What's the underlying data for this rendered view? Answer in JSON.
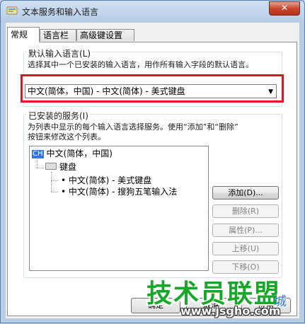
{
  "window": {
    "title": "文本服务和输入语言",
    "close_glyph": "✕"
  },
  "tabs": [
    {
      "label": "常规",
      "active": true
    },
    {
      "label": "语言栏",
      "active": false
    },
    {
      "label": "高级键设置",
      "active": false
    }
  ],
  "default_language": {
    "group_label": "默认输入语言(L)",
    "description": "选择其中一个已安装的输入语言，用作所有输入字段的默认语言。",
    "selected": "中文(简体，中国) - 中文(简体) - 美式键盘",
    "dropdown_arrow": "▼"
  },
  "installed_services": {
    "group_label": "已安装的服务(I)",
    "description_line1": "为列表中显示的每个输入语言选择服务。使用“添加”和“删除”",
    "description_line2": "按钮来修改这个列表。",
    "tree": {
      "language_badge": "CH",
      "language": "中文(简体，中国)",
      "category": "键盘",
      "items": [
        "•  中文(简体) - 美式键盘",
        "•  中文(简体) - 搜狗五笔输入法"
      ]
    },
    "buttons": {
      "add": "添加(D)...",
      "remove": "删除(R)",
      "properties": "属性(P)...",
      "move_up": "上移(U)",
      "move_down": "下移(O)"
    }
  },
  "footer": {
    "ok": "确定",
    "cancel": "取消",
    "apply": "应用"
  },
  "watermark": {
    "brand": "技术员联盟",
    "url": "www.jsgho.com",
    "side": "城"
  },
  "colors": {
    "highlight": "#e0141e",
    "badge": "#3377d4",
    "watermark_green": "#18a829"
  }
}
